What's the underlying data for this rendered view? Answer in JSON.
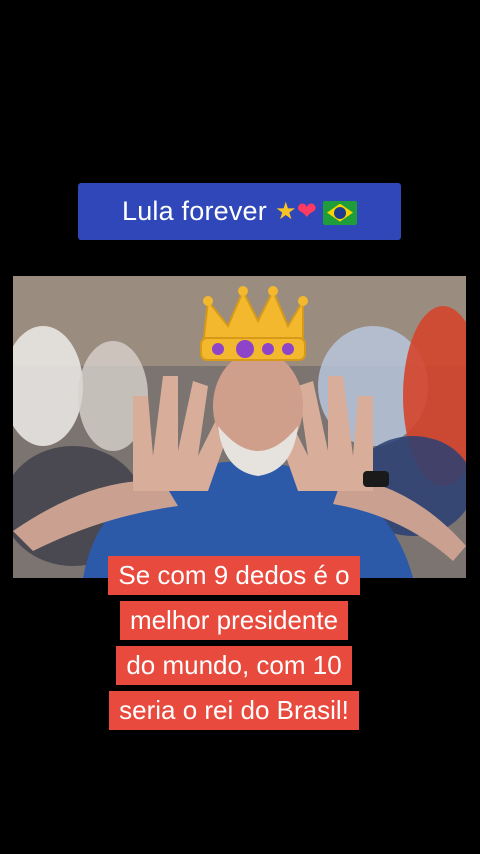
{
  "banner": {
    "text": "Lula forever",
    "emojis": [
      "star-emoji",
      "heart-emoji",
      "brazil-flag-emoji"
    ]
  },
  "photo": {
    "description_icon": "crown-emoji"
  },
  "caption": {
    "lines": [
      "Se com 9 dedos é o",
      "melhor presidente",
      "do mundo, com 10",
      "seria o rei do Brasil!"
    ]
  },
  "colors": {
    "banner_bg": "#2f47b8",
    "caption_bg": "#e84a3e",
    "page_bg": "#000000"
  }
}
